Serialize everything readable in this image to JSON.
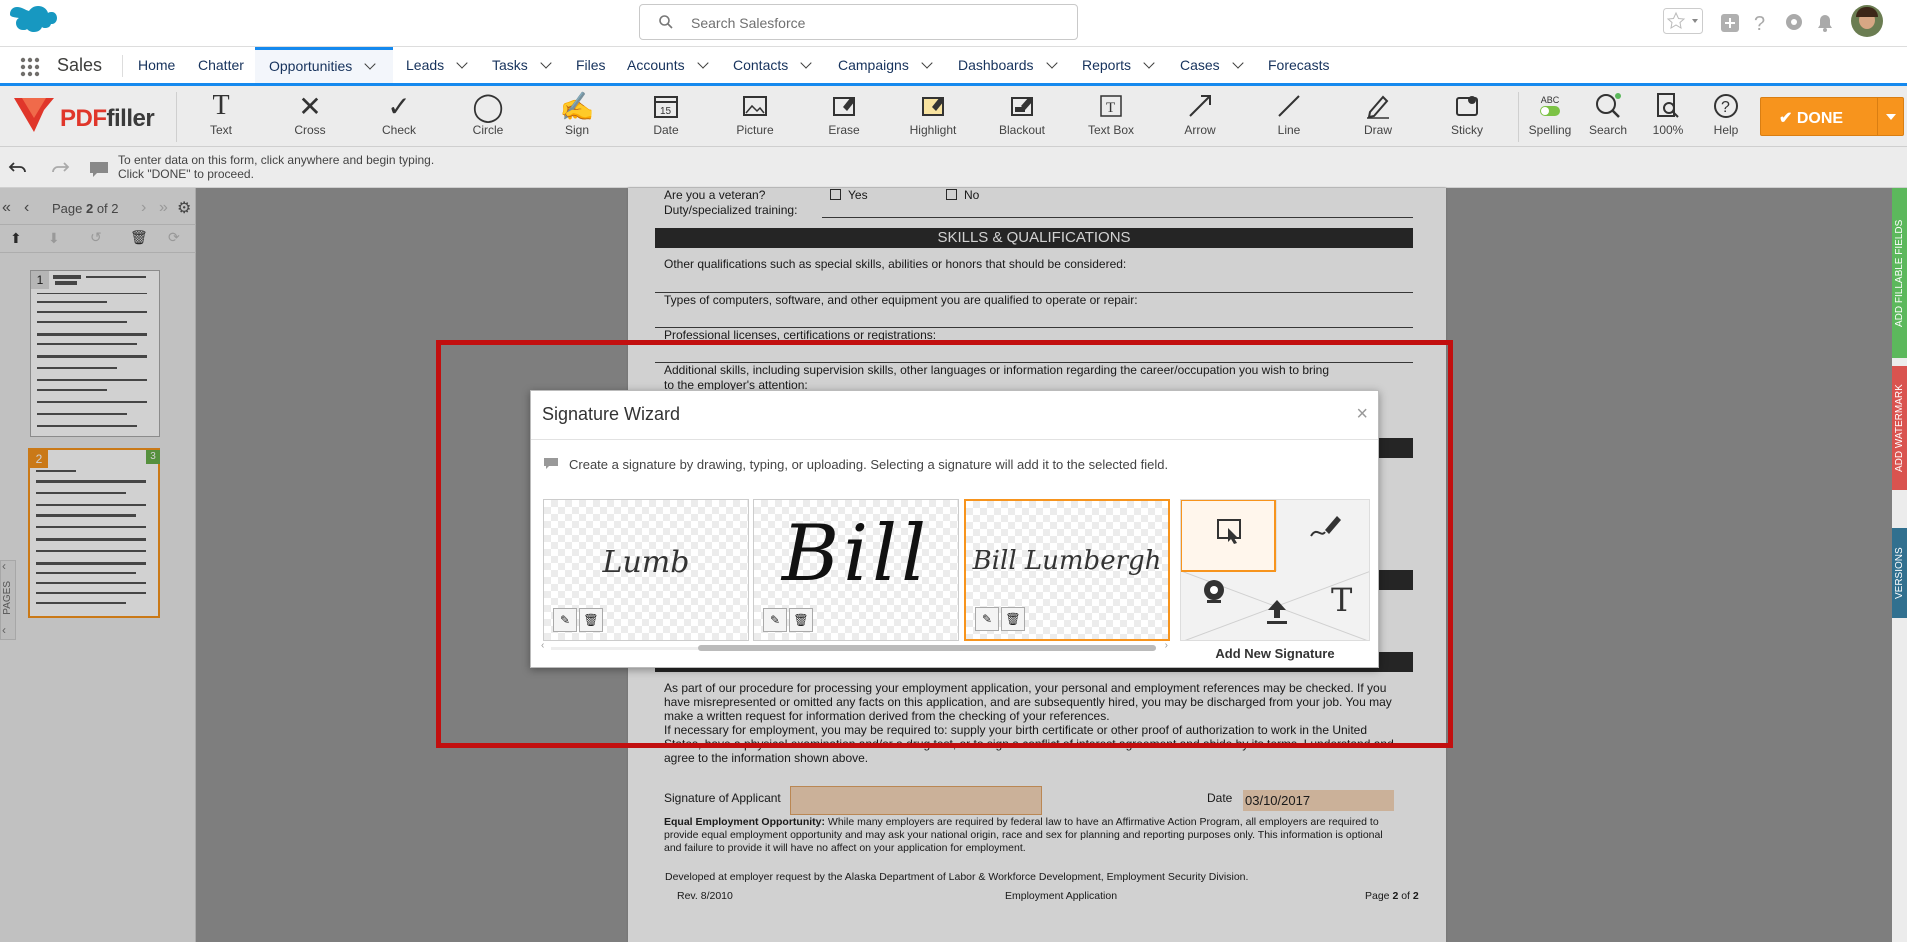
{
  "top": {
    "search_placeholder": "Search Salesforce"
  },
  "nav": {
    "app_name": "Sales",
    "items": [
      {
        "label": "Home",
        "dropdown": false
      },
      {
        "label": "Chatter",
        "dropdown": false
      },
      {
        "label": "Opportunities",
        "dropdown": true,
        "active": true
      },
      {
        "label": "Leads",
        "dropdown": true
      },
      {
        "label": "Tasks",
        "dropdown": true
      },
      {
        "label": "Files",
        "dropdown": false
      },
      {
        "label": "Accounts",
        "dropdown": true
      },
      {
        "label": "Contacts",
        "dropdown": true
      },
      {
        "label": "Campaigns",
        "dropdown": true
      },
      {
        "label": "Dashboards",
        "dropdown": true
      },
      {
        "label": "Reports",
        "dropdown": true
      },
      {
        "label": "Cases",
        "dropdown": true
      },
      {
        "label": "Forecasts",
        "dropdown": false
      }
    ]
  },
  "toolbar": {
    "logo": "PDFfiller",
    "tools": [
      "Text",
      "Cross",
      "Check",
      "Circle",
      "Sign",
      "Date",
      "Picture",
      "Erase",
      "Highlight",
      "Blackout",
      "Text Box",
      "Arrow",
      "Line",
      "Draw",
      "Sticky"
    ],
    "right_tools": [
      "Spelling",
      "Search",
      "100%",
      "Help"
    ],
    "spelling_badge": "ABC",
    "done_label": "DONE"
  },
  "hint": {
    "line1": "To enter data on this form, click anywhere and begin typing.",
    "line2": "Click \"DONE\" to proceed."
  },
  "pages": {
    "label_prefix": "Page ",
    "current": "2",
    "label_mid": " of ",
    "total": "2",
    "thumb1_num": "1",
    "thumb2_num": "2",
    "thumb2_badge": "3",
    "side_tab": "PAGES"
  },
  "right_tabs": [
    "ADD FILLABLE FIELDS",
    "ADD WATERMARK",
    "VERSIONS"
  ],
  "document": {
    "veteran_q": "Are you a veteran?",
    "yes": "Yes",
    "no": "No",
    "duty": "Duty/specialized training:",
    "skills_header": "SKILLS & QUALIFICATIONS",
    "q1": "Other qualifications such as special skills, abilities or honors that should be considered:",
    "q2": "Types of computers, software, and other equipment you are qualified to operate or repair:",
    "q3": "Professional licenses, certifications or registrations:",
    "q4a": "Additional skills, including supervision skills, other languages or information regarding the career/occupation you wish to bring",
    "q4b": "to the employer's attention:",
    "p1": "As part of our procedure for processing your employment application, your personal and employment references may be checked. If you",
    "p2": "have misrepresented or omitted any facts on this application, and are subsequently hired, you may be discharged from your job. You may",
    "p3": "make a written request for information derived from the checking of your references.",
    "p4": "If necessary for employment, you may be required to: supply your birth certificate or other proof of authorization to work in the United",
    "p5": "States, have a physical examination and/or a drug test, or to sign a conflict of interest agreement and abide by its terms. I understand and",
    "p6": "agree to the information shown above.",
    "sig_label": "Signature of Applicant",
    "date_label": "Date",
    "date_value": "03/10/2017",
    "eeo_bold": "Equal Employment Opportunity:",
    "eeo1": " While many employers are required by federal law to have an Affirmative Action Program, all employers are required to",
    "eeo2": "provide equal employment opportunity and may ask your national origin, race and sex for planning and reporting purposes only. This information is optional",
    "eeo3": "and failure to provide it will have no affect on your application for employment.",
    "dev": "Developed at employer request by the Alaska Department of Labor & Workforce Development, Employment Security Division.",
    "rev": "Rev. 8/2010",
    "footer_mid": "Employment Application",
    "footer_page": "Page ",
    "footer_page_num": "2",
    "footer_of": " of ",
    "footer_total": "2"
  },
  "modal": {
    "title": "Signature Wizard",
    "close": "×",
    "desc": "Create a signature by drawing, typing, or uploading. Selecting a signature will add it to the selected field.",
    "sig1": "Lumb",
    "sig2": "Bill",
    "sig3": "Bill Lumbergh",
    "add_label": "Add New Signature"
  },
  "colors": {
    "accent_orange": "#f7941d",
    "highlight_red": "#c20f0f",
    "sf_blue": "#1589ee"
  }
}
